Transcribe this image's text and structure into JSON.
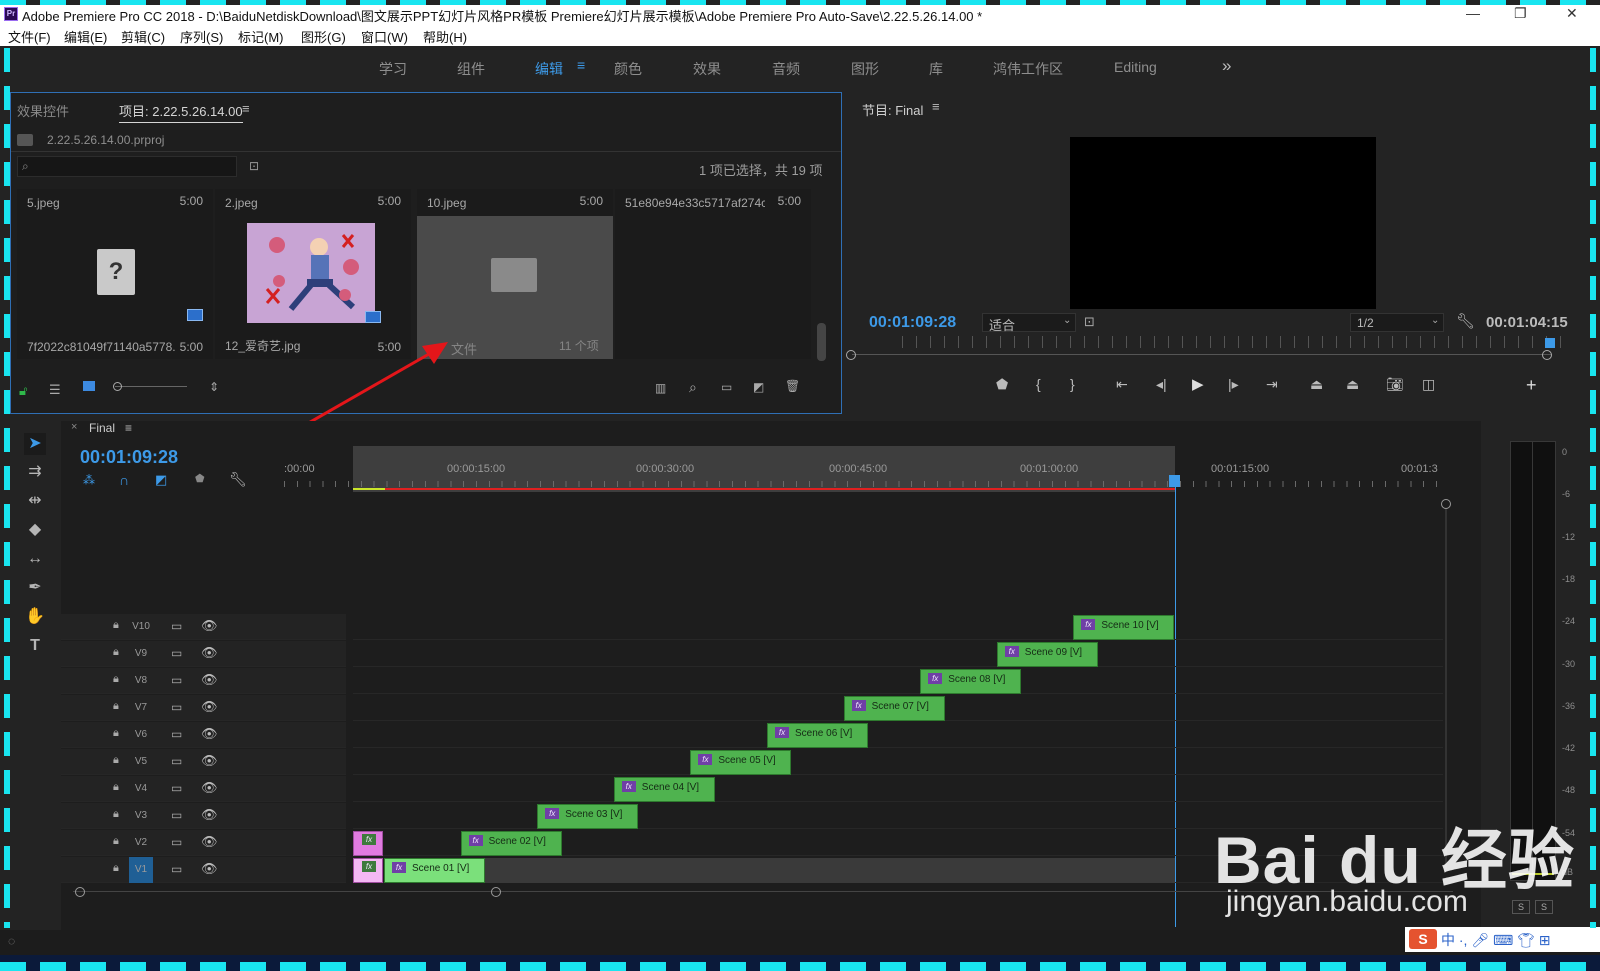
{
  "window": {
    "title": "Adobe Premiere Pro CC 2018 - D:\\BaiduNetdiskDownload\\图文展示PPT幻灯片风格PR模板 Premiere幻灯片展示模板\\Adobe Premiere Pro Auto-Save\\2.22.5.26.14.00 *",
    "logo": "Pr"
  },
  "menu": [
    "文件(F)",
    "编辑(E)",
    "剪辑(C)",
    "序列(S)",
    "标记(M)",
    "图形(G)",
    "窗口(W)",
    "帮助(H)"
  ],
  "workspaces": {
    "items": [
      "学习",
      "组件",
      "编辑",
      "颜色",
      "效果",
      "音频",
      "图形",
      "库",
      "鸿伟工作区",
      "Editing"
    ],
    "active": "编辑",
    "more": "»"
  },
  "project": {
    "tab_effects": "效果控件",
    "tab_project": "项目: 2.22.5.26.14.00",
    "file": "2.22.5.26.14.00.prproj",
    "selection_info": "1 项已选择，共 19 项",
    "items": [
      {
        "name": "5.jpeg",
        "duration": "5:00"
      },
      {
        "name": "2.jpeg",
        "duration": "5:00"
      },
      {
        "name": "10.jpeg",
        "duration": "5:00"
      },
      {
        "name": "51e80e94e33c5717af274c...",
        "duration": "5:00"
      },
      {
        "name": "7f2022c81049f71140a5778...",
        "duration": "5:00"
      },
      {
        "name": "12_爱奇艺.jpg",
        "duration": "5:00"
      },
      {
        "name": "文件",
        "count": "11 个项"
      }
    ]
  },
  "monitor": {
    "title": "节目: Final",
    "timecode": "00:01:09:28",
    "fit": "适合",
    "resolution": "1/2",
    "duration": "00:01:04:15"
  },
  "timeline": {
    "sequence": "Final",
    "timecode": "00:01:09:28",
    "ruler": [
      ":00:00",
      "00:00:15:00",
      "00:00:30:00",
      "00:00:45:00",
      "00:01:00:00",
      "00:01:15:00",
      "00:01:3"
    ],
    "tracks": [
      "V10",
      "V9",
      "V8",
      "V7",
      "V6",
      "V5",
      "V4",
      "V3",
      "V2",
      "V1"
    ],
    "clips": [
      {
        "label": "Scene 01 [V]",
        "track": "V1"
      },
      {
        "label": "Scene 02 [V]",
        "track": "V2"
      },
      {
        "label": "Scene 03 [V]",
        "track": "V3"
      },
      {
        "label": "Scene 04 [V]",
        "track": "V4"
      },
      {
        "label": "Scene 05 [V]",
        "track": "V5"
      },
      {
        "label": "Scene 06 [V]",
        "track": "V6"
      },
      {
        "label": "Scene 07 [V]",
        "track": "V7"
      },
      {
        "label": "Scene 08 [V]",
        "track": "V8"
      },
      {
        "label": "Scene 09 [V]",
        "track": "V9"
      },
      {
        "label": "Scene 10 [V]",
        "track": "V10"
      }
    ],
    "fx_label": "fx"
  },
  "meter": {
    "scale": [
      "0",
      "-6",
      "-12",
      "-18",
      "-24",
      "-30",
      "-36",
      "-42",
      "-48",
      "-54",
      "dB"
    ],
    "solo": [
      "S",
      "S"
    ]
  },
  "watermark": {
    "brand": "Bai du 经验",
    "url": "jingyan.baidu.com"
  },
  "colors": {
    "accent": "#3d9ae8",
    "clip": "#4fb34f",
    "fx": "#6f3fa6",
    "playhead_bar": "#e02020",
    "arrow": "#e4161a"
  }
}
